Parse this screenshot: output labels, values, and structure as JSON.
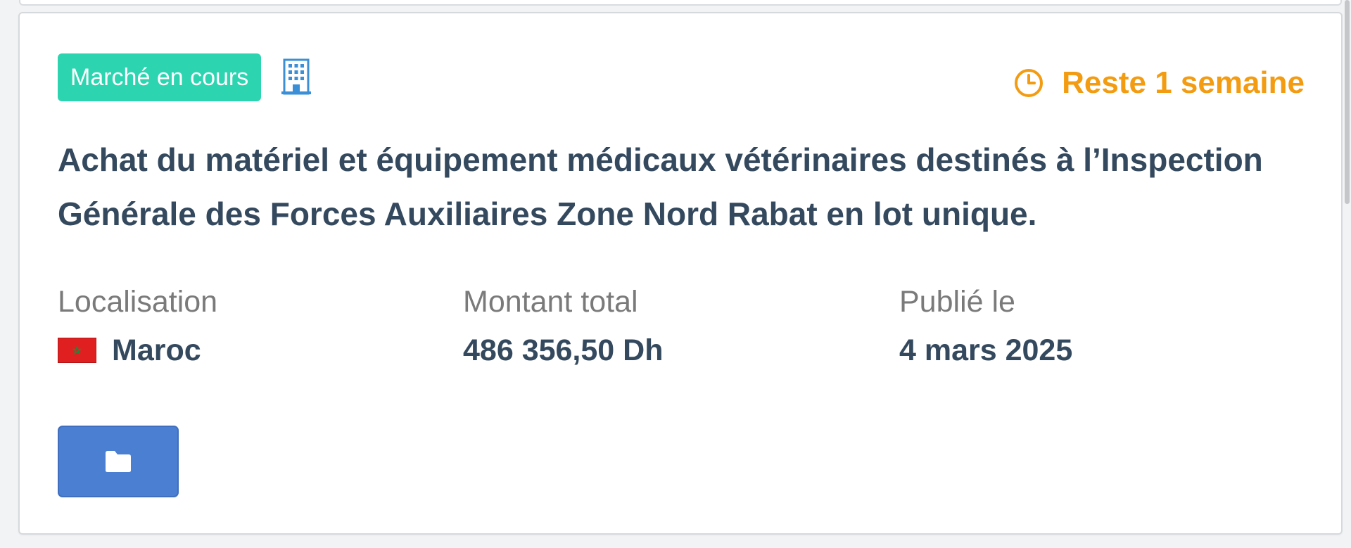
{
  "card": {
    "status_badge": "Marché en cours",
    "building_icon": "building-icon",
    "clock_icon": "clock-icon",
    "time_left": "Reste 1 semaine",
    "title": "Achat du matériel et équipement médicaux vétérinaires destinés à l’Inspection Générale des Forces Auxiliaires Zone Nord Rabat en lot unique.",
    "localisation": {
      "label": "Localisation",
      "flag_icon": "morocco-flag-icon",
      "value": "Maroc"
    },
    "montant": {
      "label": "Montant total",
      "value": "486 356,50 Dh"
    },
    "publie": {
      "label": "Publié le",
      "value": "4 mars 2025"
    },
    "folder_button_icon": "folder-icon"
  },
  "colors": {
    "badge": "#2dd4b0",
    "accent_orange": "#f39c12",
    "title_text": "#34495e",
    "label_text": "#7a7a7a",
    "button_blue": "#4a7fd2",
    "building_icon": "#3a8fd6",
    "flag_red": "#e02020",
    "flag_star": "#1a8a3a"
  }
}
